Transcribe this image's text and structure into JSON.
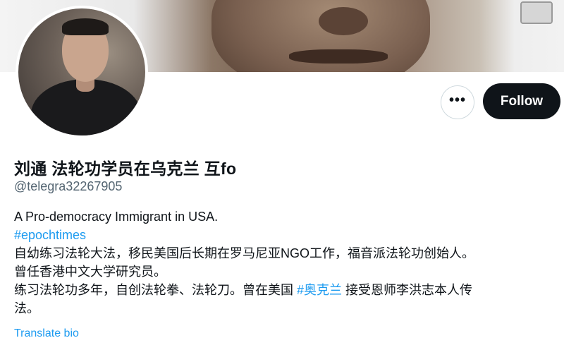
{
  "profile": {
    "display_name": "刘通 法轮功学员在乌克兰 互fo",
    "handle": "@telegra32267905"
  },
  "actions": {
    "more_label": "•••",
    "follow_label": "Follow"
  },
  "bio": {
    "line1": "A Pro-democracy Immigrant in USA.",
    "hashtag1": "#epochtimes",
    "line3": "自幼练习法轮大法，移民美国后长期在罗马尼亚NGO工作，福音派法轮功创始人。",
    "line4": "曾任香港中文大学研究员。",
    "line5_before": "练习法轮功多年，自创法轮拳、法轮刀。曾在美国 ",
    "hashtag2": "#奥克兰",
    "line5_after": " 接受恩师李洪志本人传",
    "line6": "法。"
  },
  "translate_label": "Translate bio",
  "colors": {
    "link": "#1d9bf0",
    "follow_bg": "#0f1419",
    "secondary_text": "#536471"
  },
  "icons": {
    "more": "more-options-icon"
  }
}
